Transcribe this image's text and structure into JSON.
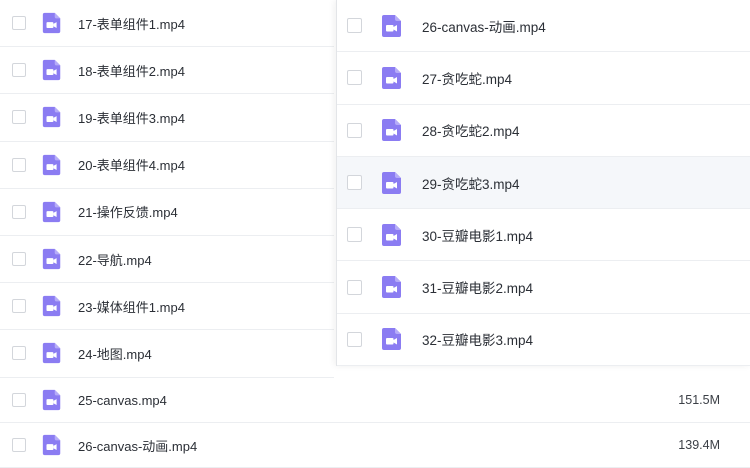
{
  "icon": "video-file-icon",
  "colors": {
    "icon_fill": "#8b7cf2",
    "row_hover": "#f5f7fa",
    "border": "#eceef1"
  },
  "left_list": [
    {
      "name": "17-表单组件1.mp4"
    },
    {
      "name": "18-表单组件2.mp4"
    },
    {
      "name": "19-表单组件3.mp4"
    },
    {
      "name": "20-表单组件4.mp4"
    },
    {
      "name": "21-操作反馈.mp4"
    },
    {
      "name": "22-导航.mp4"
    },
    {
      "name": "23-媒体组件1.mp4"
    },
    {
      "name": "24-地图.mp4"
    }
  ],
  "bottom_list": [
    {
      "name": "25-canvas.mp4",
      "size": "151.5M"
    },
    {
      "name": "26-canvas-动画.mp4",
      "size": "139.4M"
    }
  ],
  "drag_panel": [
    {
      "name": "26-canvas-动画.mp4"
    },
    {
      "name": "27-贪吃蛇.mp4"
    },
    {
      "name": "28-贪吃蛇2.mp4"
    },
    {
      "name": "29-贪吃蛇3.mp4"
    },
    {
      "name": "30-豆瓣电影1.mp4"
    },
    {
      "name": "31-豆瓣电影2.mp4"
    },
    {
      "name": "32-豆瓣电影3.mp4"
    }
  ]
}
